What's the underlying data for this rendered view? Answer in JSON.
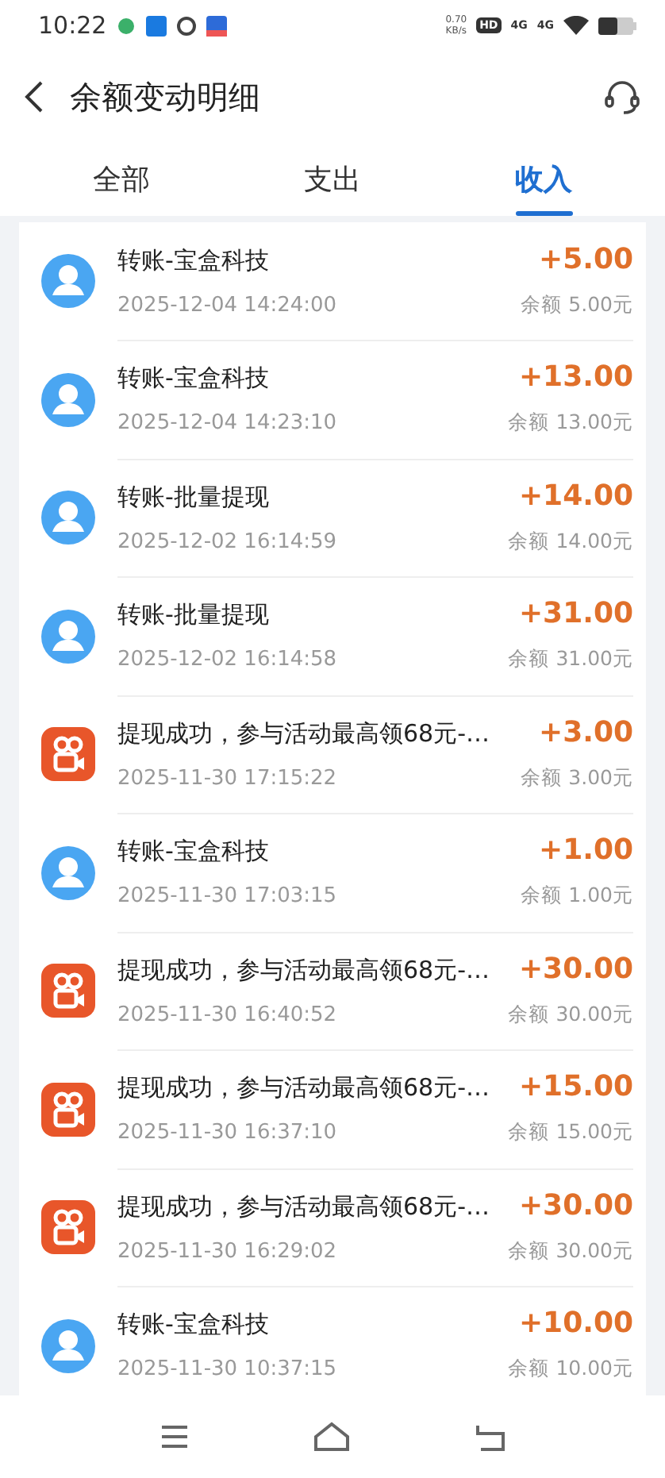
{
  "status_bar": {
    "time": "10:22",
    "net_speed": [
      "0.70",
      "KB/s"
    ],
    "hd": "HD",
    "signals": [
      "4G",
      "4G"
    ]
  },
  "header": {
    "title": "余额变动明细"
  },
  "tabs": [
    {
      "label": "全部",
      "selected": false
    },
    {
      "label": "支出",
      "selected": false
    },
    {
      "label": "收入",
      "selected": true
    }
  ],
  "transactions": [
    {
      "kind": "person",
      "title": "转账-宝盒科技",
      "time": "2025-12-04 14:24:00",
      "amount": "+5.00",
      "balance": "余额 5.00元"
    },
    {
      "kind": "person",
      "title": "转账-宝盒科技",
      "time": "2025-12-04 14:23:10",
      "amount": "+13.00",
      "balance": "余额 13.00元"
    },
    {
      "kind": "person",
      "title": "转账-批量提现",
      "time": "2025-12-02 16:14:59",
      "amount": "+14.00",
      "balance": "余额 14.00元"
    },
    {
      "kind": "person",
      "title": "转账-批量提现",
      "time": "2025-12-02 16:14:58",
      "amount": "+31.00",
      "balance": "余额 31.00元"
    },
    {
      "kind": "app",
      "title": "提现成功，参与活动最高领68元-…",
      "time": "2025-11-30 17:15:22",
      "amount": "+3.00",
      "balance": "余额 3.00元"
    },
    {
      "kind": "person",
      "title": "转账-宝盒科技",
      "time": "2025-11-30 17:03:15",
      "amount": "+1.00",
      "balance": "余额 1.00元"
    },
    {
      "kind": "app",
      "title": "提现成功，参与活动最高领68元-…",
      "time": "2025-11-30 16:40:52",
      "amount": "+30.00",
      "balance": "余额 30.00元"
    },
    {
      "kind": "app",
      "title": "提现成功，参与活动最高领68元-…",
      "time": "2025-11-30 16:37:10",
      "amount": "+15.00",
      "balance": "余额 15.00元"
    },
    {
      "kind": "app",
      "title": "提现成功，参与活动最高领68元-…",
      "time": "2025-11-30 16:29:02",
      "amount": "+30.00",
      "balance": "余额 30.00元"
    },
    {
      "kind": "person",
      "title": "转账-宝盒科技",
      "time": "2025-11-30 10:37:15",
      "amount": "+10.00",
      "balance": "余额 10.00元"
    }
  ]
}
